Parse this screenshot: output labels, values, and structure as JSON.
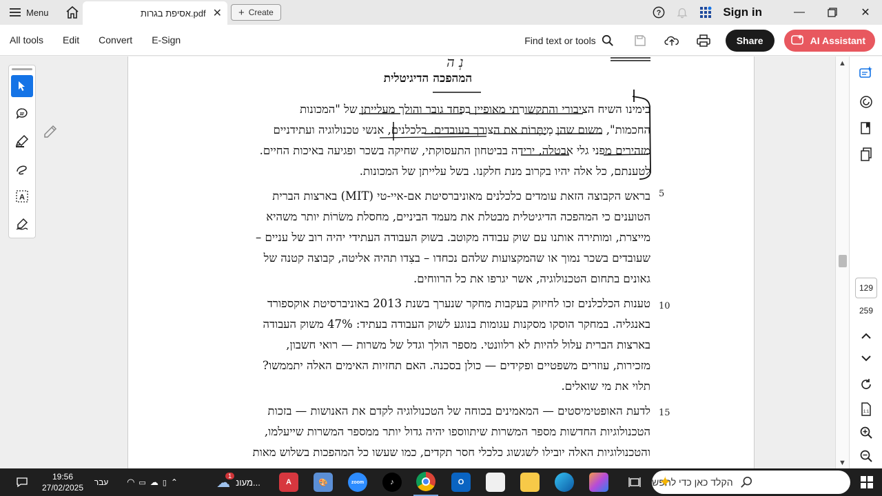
{
  "titlebar": {
    "menu_label": "Menu",
    "tab_title": "אסיפת בגרות.pdf",
    "create_label": "Create",
    "signin_label": "Sign in"
  },
  "toolbar": {
    "items": [
      "All tools",
      "Edit",
      "Convert",
      "E-Sign"
    ],
    "find_label": "Find text or tools",
    "share_label": "Share",
    "ai_label": "AI Assistant"
  },
  "document": {
    "handwritten_title": "נ‏ְ‏ ‏ה",
    "heading": "המהפכה הדיגיטלית",
    "paragraphs": [
      {
        "lines": [
          "בימינו השיח הציבורי והתקשורתי מאופיין בפחד גובר והולך מעלייתן של \"המכונות",
          "החכמות\", משום שהן מְיַתְּרוֹת את הצורך בעובדים. כלכלנים, אנשי טכנולוגיה ועתידניים",
          "מזהירים מפני גלי אבטלה, ירידה בביטחון התעסוקתי, שחיקה בשכר ופגיעה באיכות החיים.",
          "לטענתם, כל אלה יהיו בקרוב מנת חלקנו. בשל עלייתן של המכונות."
        ],
        "line_number": ""
      },
      {
        "lines": [
          "בראש הקבוצה הזאת עומדים כלכלנים מאוניברסיטת אם-איי-טי (MIT) בארצות הברית",
          "הטוענים כי המהפכה הדיגיטלית מבטלת את מעמד הביניים, מחסלת משׂרוֹת יותר משהיא",
          "מייצרת, ומותירה אותנו עם שוק עבודה מקוטב. בשוק העבודה העתידי יהיה רוב של עניים –",
          "שעובדים בשכר נמוך או שהמקצועות שלהם נכחדו – בצִדו תהיה אליטה, קבוצה קטנה של",
          "גאונים בתחום הטכנולוגיה, אשר יגרפו את כל הרווחים."
        ],
        "line_number": "5"
      },
      {
        "lines": [
          "טענות הכלכלנים זכו לחיזוק בעקבות מחקר שנערך בשנת 2013 באוניברסיטת אוקספורד",
          "באנגליה. במחקר הוסקו מסקנות עגומות בנוגע לשוק העבודה בעתיד: 47% משוק העבודה",
          "בארצות הברית עלול להיות לא רלוונטי. מספר הולך וגדל של משרות — רואי חשבון,",
          "מזכירות, עוזרים משפטיים ופקידים — כולן בסכנה. האם תחזיות האימים האלה יתממשו?",
          "תלוי את מי שואלים."
        ],
        "line_number": "10"
      },
      {
        "lines": [
          "לדעת האופטימיסטים — המאמינים בכוחה של הטכנולוגיה לקדם את האנושות — בזכות",
          "הטכנולוגיות החדשות מספר המשרות שיתווספו יהיה גדול יותר ממספר המשרות שייעלמו,",
          "והטכנולוגיות האלה יובילו לשגשוג כלכלי חסר תקדים, כמו שעשו כל המהפכות בשלוש מאות"
        ],
        "line_number": "15"
      }
    ]
  },
  "pagination": {
    "current_page": "129",
    "total_pages": "259"
  },
  "taskbar": {
    "search_placeholder": "הקלד כאן כדי לחפש",
    "weather_label": "מעונ...",
    "weather_badge": "1",
    "language": "עבר",
    "time": "19:56",
    "date": "27/02/2025"
  },
  "colors": {
    "accent_blue": "#1473e6",
    "ai_red": "#e8585f",
    "share_dark": "#1b1b1b",
    "taskbar_bg": "#1f1f1f"
  }
}
